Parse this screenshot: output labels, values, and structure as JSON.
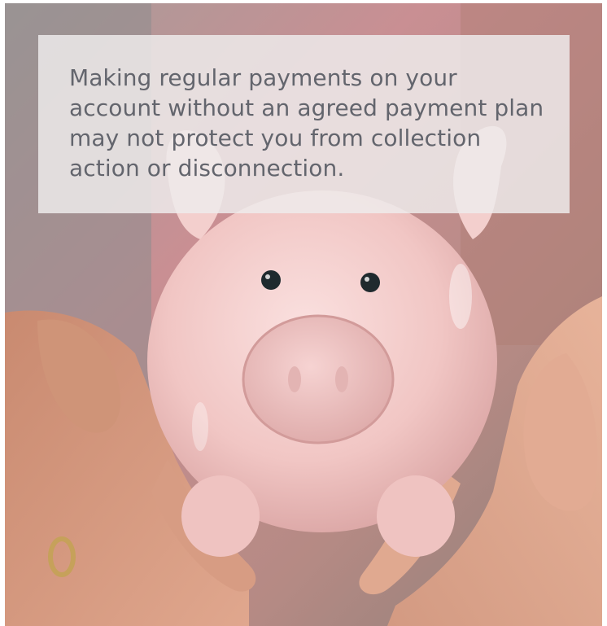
{
  "caption": {
    "text": "Making regular payments on your account without an agreed payment plan may not protect you from collection action or disconnection."
  },
  "photo": {
    "subject": "pink-piggy-bank-held-in-hands-icon",
    "colors": {
      "piggy_bank": "#f2c9c7",
      "skin": "#d49a80",
      "background_top": "#c98b90",
      "background_left": "#8f8c8b"
    }
  }
}
